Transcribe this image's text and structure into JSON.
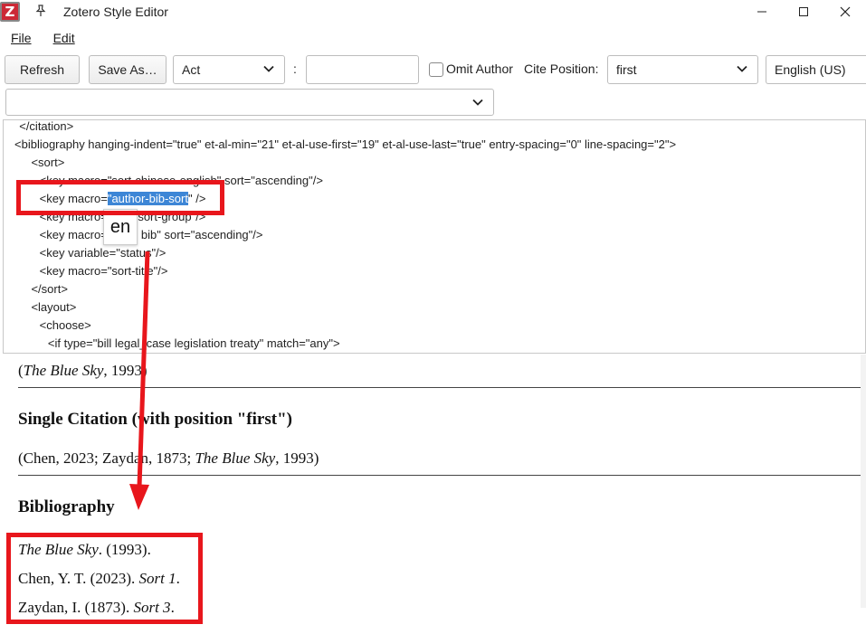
{
  "window": {
    "app_icon": "Z",
    "title": "Zotero Style Editor",
    "pin_icon": "pin-icon",
    "controls": [
      "—",
      "☐",
      "✕"
    ]
  },
  "menu": {
    "file": "File",
    "edit": "Edit"
  },
  "toolbar": {
    "refresh": "Refresh",
    "save_as": "Save As…",
    "locator_type": "Act",
    "colon": ":",
    "locator_value": "",
    "omit_author": "Omit Author",
    "cite_position_label": "Cite Position:",
    "cite_position": "first",
    "locale": "English (US)",
    "secondary_select": ""
  },
  "editor": {
    "lines": [
      "  </citation>",
      "<bibliography hanging-indent=\"true\" et-al-min=\"21\" et-al-use-first=\"19\" et-al-use-last=\"true\" entry-spacing=\"0\" line-spacing=\"2\">",
      "    <sort>",
      "      <key macro=\"sort-chinese-english\" sort=\"ascending\"/>",
      "",
      "      <key macro=\"        sort-group\"/>",
      "      <key macro=\"         bib\" sort=\"ascending\"/>",
      "      <key variable=\"status\"/>",
      "      <key macro=\"sort-title\"/>",
      "    </sort>",
      "    <layout>",
      "      <choose>",
      "        <if type=\"bill legal_case legislation treaty\" match=\"any\">"
    ],
    "line5_prefix": "      <key macro=",
    "line5_selected": "\"author-bib-sort",
    "line5_suffix": "\" />",
    "autocomplete": "en"
  },
  "preview": {
    "top_citation_title": "The Blue Sky",
    "top_citation_rest": ", 1993)",
    "top_citation_open": "(",
    "single_heading": "Single Citation (with position \"first\")",
    "single_citation_prefix": "(Chen, 2023; Zaydan, 1873; ",
    "single_citation_title": "The Blue Sky",
    "single_citation_suffix": ", 1993)",
    "bib_heading": "Bibliography",
    "bib_entries": [
      {
        "italic_first": "The Blue Sky",
        "rest": ". (1993)."
      },
      {
        "plain": "Chen, Y. T. (2023). ",
        "italic": "Sort 1",
        "end": "."
      },
      {
        "plain": "Zaydan, I. (1873). ",
        "italic": "Sort 3",
        "end": "."
      }
    ]
  },
  "colors": {
    "annotation_red": "#e8161c",
    "selection_blue": "#3d86d6"
  }
}
